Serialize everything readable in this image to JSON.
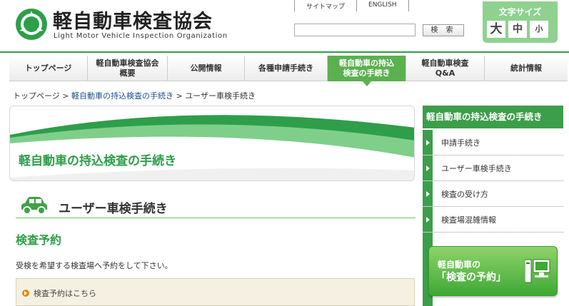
{
  "header": {
    "logo_title": "軽自動車検査協会",
    "logo_subtitle": "Light Motor Vehicle Inspection Organization",
    "top_links": [
      "サイトマップ",
      "ENGLISH"
    ],
    "search_placeholder": "",
    "search_button": "検 索",
    "font_size_title": "文字サイズ",
    "font_size_large": "大",
    "font_size_medium": "中",
    "font_size_small": "小"
  },
  "nav": {
    "items": [
      {
        "label": "トップページ"
      },
      {
        "label": "軽自動車検査協会\n概要"
      },
      {
        "label": "公開情報"
      },
      {
        "label": "各種申請手続き"
      },
      {
        "label": "軽自動車の持込\n検査の手続き"
      },
      {
        "label": "軽自動車検査\nQ&A"
      },
      {
        "label": "統計情報"
      }
    ]
  },
  "breadcrumb": {
    "home": "トップページ",
    "sep": ">",
    "parent": "軽自動車の持込検査の手続き",
    "current": "ユーザー車検手続き"
  },
  "main": {
    "banner_title": "軽自動車の持込検査の手続き",
    "section_title": "ユーザー車検手続き",
    "sub_title": "検査予約",
    "description": "受検を希望する検査場へ予約をして下さい。",
    "reserve_link": "検査予約はこちら"
  },
  "sidebar": {
    "heading": "軽自動車の持込検査の手続き",
    "items": [
      {
        "label": "申請手続き"
      },
      {
        "label": "ユーザー車検手続き"
      },
      {
        "label": "検査の受け方"
      },
      {
        "label": "検査場混雑情報"
      }
    ],
    "banner_line1": "軽自動車の",
    "banner_line2": "「検査の予約」"
  },
  "colors": {
    "brand_green": "#2e9e4a",
    "nav_active": "#5bb04f",
    "accent_orange": "#e8891a"
  }
}
